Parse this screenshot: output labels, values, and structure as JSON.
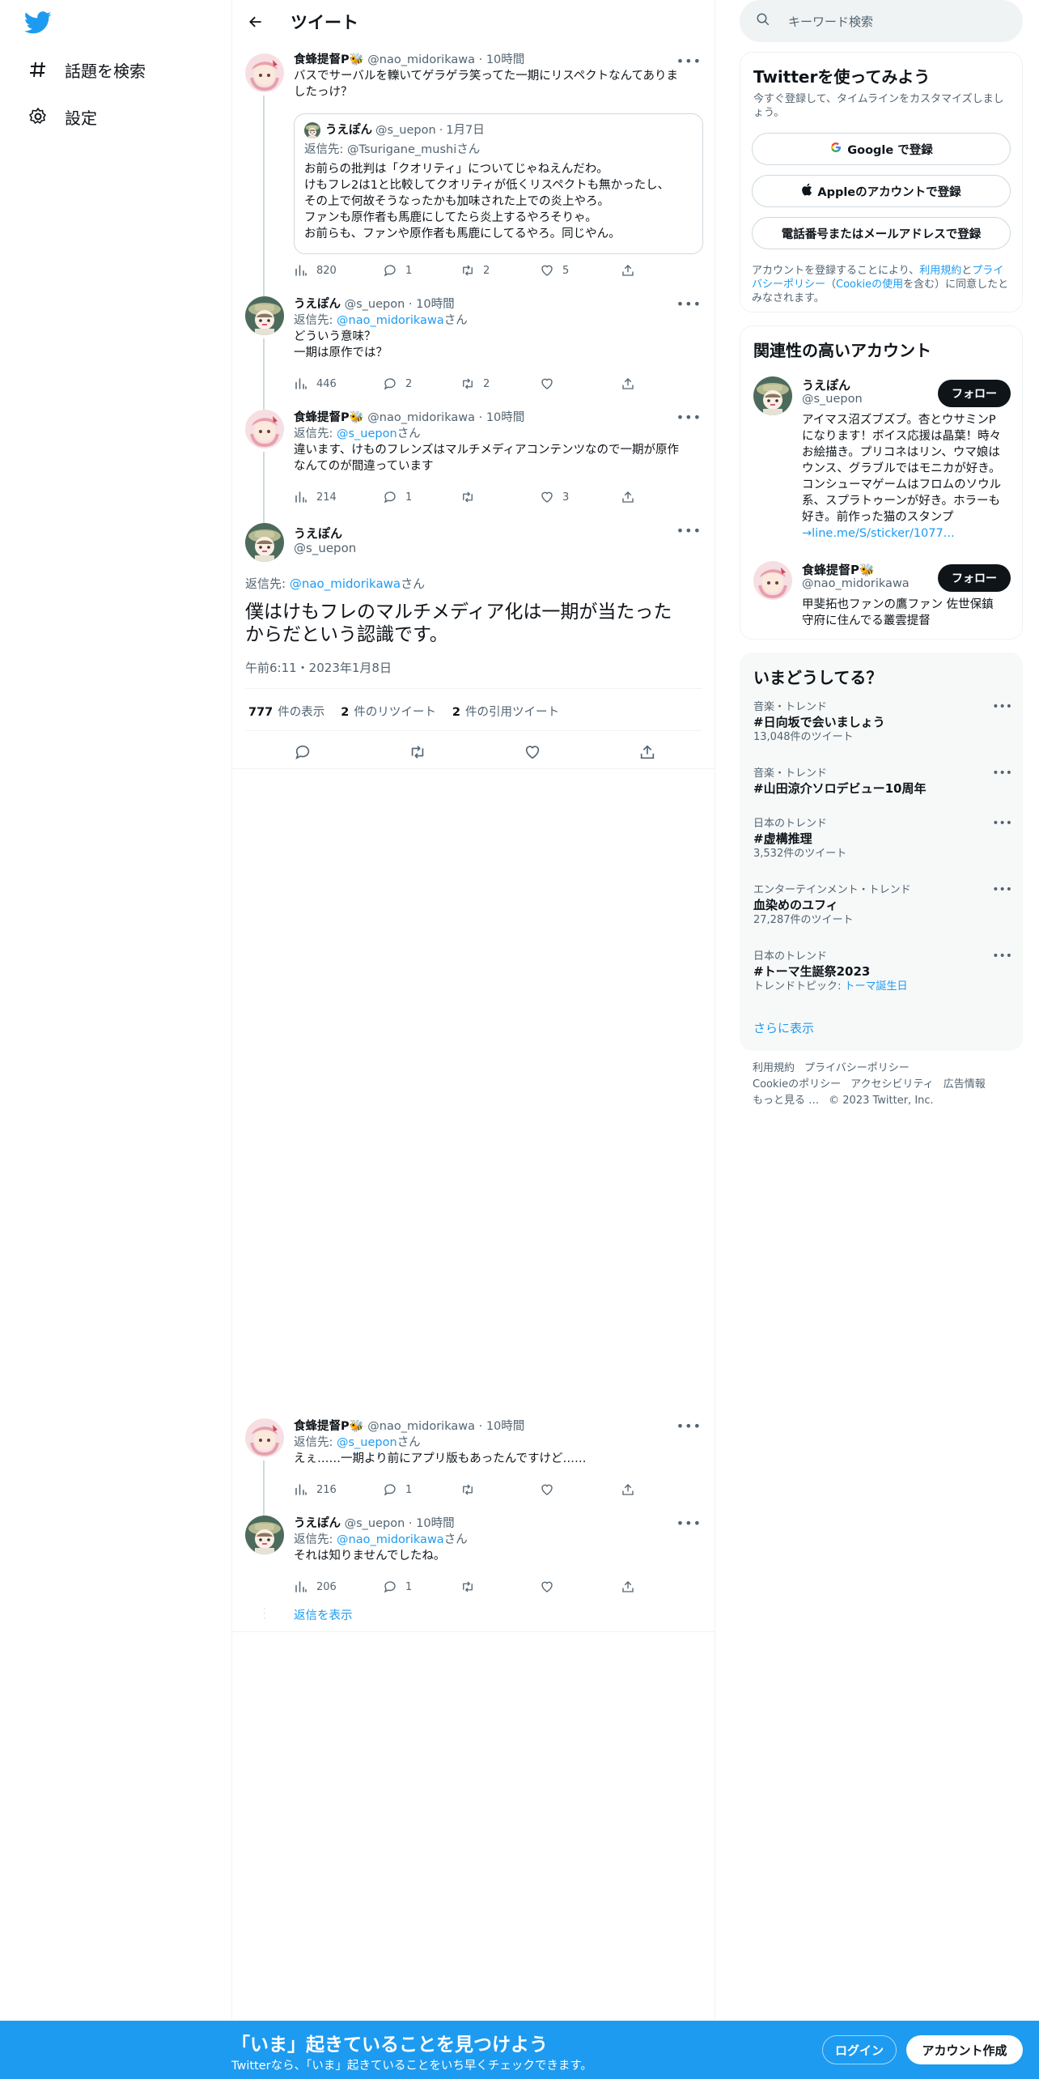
{
  "colors": {
    "accent": "#1d9bf0",
    "text": "#0f1419",
    "muted": "#536471",
    "border": "#eff3f4"
  },
  "nav": {
    "logo_icon": "twitter-bird-icon",
    "items": [
      {
        "label": "話題を検索",
        "icon": "hashtag-icon"
      },
      {
        "label": "設定",
        "icon": "gear-icon"
      }
    ]
  },
  "header": {
    "title": "ツイート",
    "back_icon": "back-arrow-icon"
  },
  "tweets": [
    {
      "name": "食蜂提督P🐝",
      "handle": "@nao_midorikawa",
      "time": "10時間",
      "text_lines": [
        "バスでサーバルを轢いてゲラゲラ笑ってた一期にリスペクトなんてありま",
        "したっけ？"
      ],
      "quote": {
        "name": "うえぽん",
        "handle": "@s_uepon",
        "time": "1月7日",
        "reply_prefix": "返信先:",
        "reply_to": "@Tsurigane_mushi",
        "reply_suffix": "さん",
        "lines": [
          "お前らの批判は「クオリティ」についてじゃねえんだわ。",
          "けもフレ2は1と比較してクオリティが低くリスペクトも無かったし、",
          "その上で何故そうなったかも加味された上での炎上やろ。",
          "ファンも原作者も馬鹿にしてたら炎上するやろそりゃ。",
          "お前らも、ファンや原作者も馬鹿にしてるやろ。同じやん。"
        ]
      },
      "views": "820",
      "replies": "1",
      "retweets": "2",
      "likes": "5"
    },
    {
      "name": "うえぽん",
      "handle": "@s_uepon",
      "time": "10時間",
      "reply_prefix": "返信先:",
      "reply_to": "@nao_midorikawa",
      "reply_suffix": "さん",
      "text_lines": [
        "どういう意味？",
        "一期は原作では？"
      ],
      "views": "446",
      "replies": "2",
      "retweets": "2",
      "likes": ""
    },
    {
      "name": "食蜂提督P🐝",
      "handle": "@nao_midorikawa",
      "time": "10時間",
      "reply_prefix": "返信先:",
      "reply_to": "@s_uepon",
      "reply_suffix": "さん",
      "text_lines": [
        "違います、けものフレンズはマルチメディアコンテンツなので一期が原作",
        "なんてのが間違っています"
      ],
      "views": "214",
      "replies": "1",
      "retweets": "",
      "likes": "3"
    }
  ],
  "focal": {
    "name": "うえぽん",
    "handle": "@s_uepon",
    "reply_prefix": "返信先:",
    "reply_to": "@nao_midorikawa",
    "reply_suffix": "さん",
    "text_lines": [
      "僕はけもフレのマルチメディア化は一期が当たった",
      "からだという認識です。"
    ],
    "timestamp": "午前6:11・2023年1月8日",
    "views_num": "777",
    "views_label": "件の表示",
    "rt_num": "2",
    "rt_label": "件のリツイート",
    "qt_num": "2",
    "qt_label": "件の引用ツイート"
  },
  "replies": [
    {
      "name": "食蜂提督P🐝",
      "handle": "@nao_midorikawa",
      "time": "10時間",
      "reply_prefix": "返信先:",
      "reply_to": "@s_uepon",
      "reply_suffix": "さん",
      "text": "えぇ……一期より前にアプリ版もあったんですけど……",
      "views": "216",
      "replies": "1",
      "retweets": "",
      "likes": ""
    },
    {
      "name": "うえぽん",
      "handle": "@s_uepon",
      "time": "10時間",
      "reply_prefix": "返信先:",
      "reply_to": "@nao_midorikawa",
      "reply_suffix": "さん",
      "text": "それは知りませんでしたね。",
      "views": "206",
      "replies": "1",
      "retweets": "",
      "likes": ""
    }
  ],
  "show_replies": "返信を表示",
  "search": {
    "placeholder": "キーワード検索"
  },
  "signup": {
    "title": "Twitterを使ってみよう",
    "subtitle": "今すぐ登録して、タイムラインをカスタマイズしましょう。",
    "google": "Google で登録",
    "apple": "Appleのアカウントで登録",
    "phone": "電話番号またはメールアドレスで登録",
    "legal_1": "アカウントを登録することにより、",
    "legal_terms": "利用規約",
    "legal_2": "と",
    "legal_privacy": "プライバシーポリシー",
    "legal_3": "（",
    "legal_cookie": "Cookieの使用",
    "legal_4": "を含む）に同意したとみなされます。"
  },
  "related": {
    "title": "関連性の高いアカウント",
    "accounts": [
      {
        "name": "うえぽん",
        "handle": "@s_uepon",
        "bio_lines": [
          "アイマス沼ズブズブ。杏とウサミンP",
          "になります！ボイス応援は晶葉！時々",
          "お絵描き。プリコネはリン、ウマ娘は",
          "ウンス、グラブルではモニカが好き。",
          "コンシューマゲームはフロムのソウル",
          "系、スプラトゥーンが好き。ホラーも",
          "好き。前作った猫のスタンプ"
        ],
        "bio_link": "→line.me/S/sticker/1077...",
        "follow": "フォロー"
      },
      {
        "name": "食蜂提督P🐝",
        "handle": "@nao_midorikawa",
        "bio_lines": [
          "甲斐拓也ファンの鷹ファン 佐世保鎮",
          "守府に住んでる叢雲提督"
        ],
        "bio_link": "",
        "follow": "フォロー"
      }
    ]
  },
  "trends": {
    "title": "いまどうしてる？",
    "items": [
      {
        "category": "音楽・トレンド",
        "name": "#日向坂で会いましょう",
        "count": "13,048件のツイート"
      },
      {
        "category": "音楽・トレンド",
        "name": "#山田涼介ソロデビュー10周年",
        "count": ""
      },
      {
        "category": "日本のトレンド",
        "name": "#虚構推理",
        "count": "3,532件のツイート"
      },
      {
        "category": "エンターテインメント・トレンド",
        "name": "血染めのユフィ",
        "count": "27,287件のツイート"
      },
      {
        "category": "日本のトレンド",
        "name": "#トーマ生誕祭2023",
        "count": "トレンドトピック: ",
        "count_link": "トーマ誕生日"
      }
    ],
    "more": "さらに表示"
  },
  "footer": {
    "line1": [
      "利用規約",
      "プライバシーポリシー"
    ],
    "line2": [
      "Cookieのポリシー",
      "アクセシビリティ",
      "広告情報"
    ],
    "line3": [
      "もっと見る …",
      "© 2023 Twitter, Inc."
    ]
  },
  "bottombar": {
    "title": "「いま」起きていることを見つけよう",
    "subtitle": "Twitterなら、「いま」起きていることをいち早くチェックできます。",
    "login": "ログイン",
    "signup": "アカウント作成"
  }
}
